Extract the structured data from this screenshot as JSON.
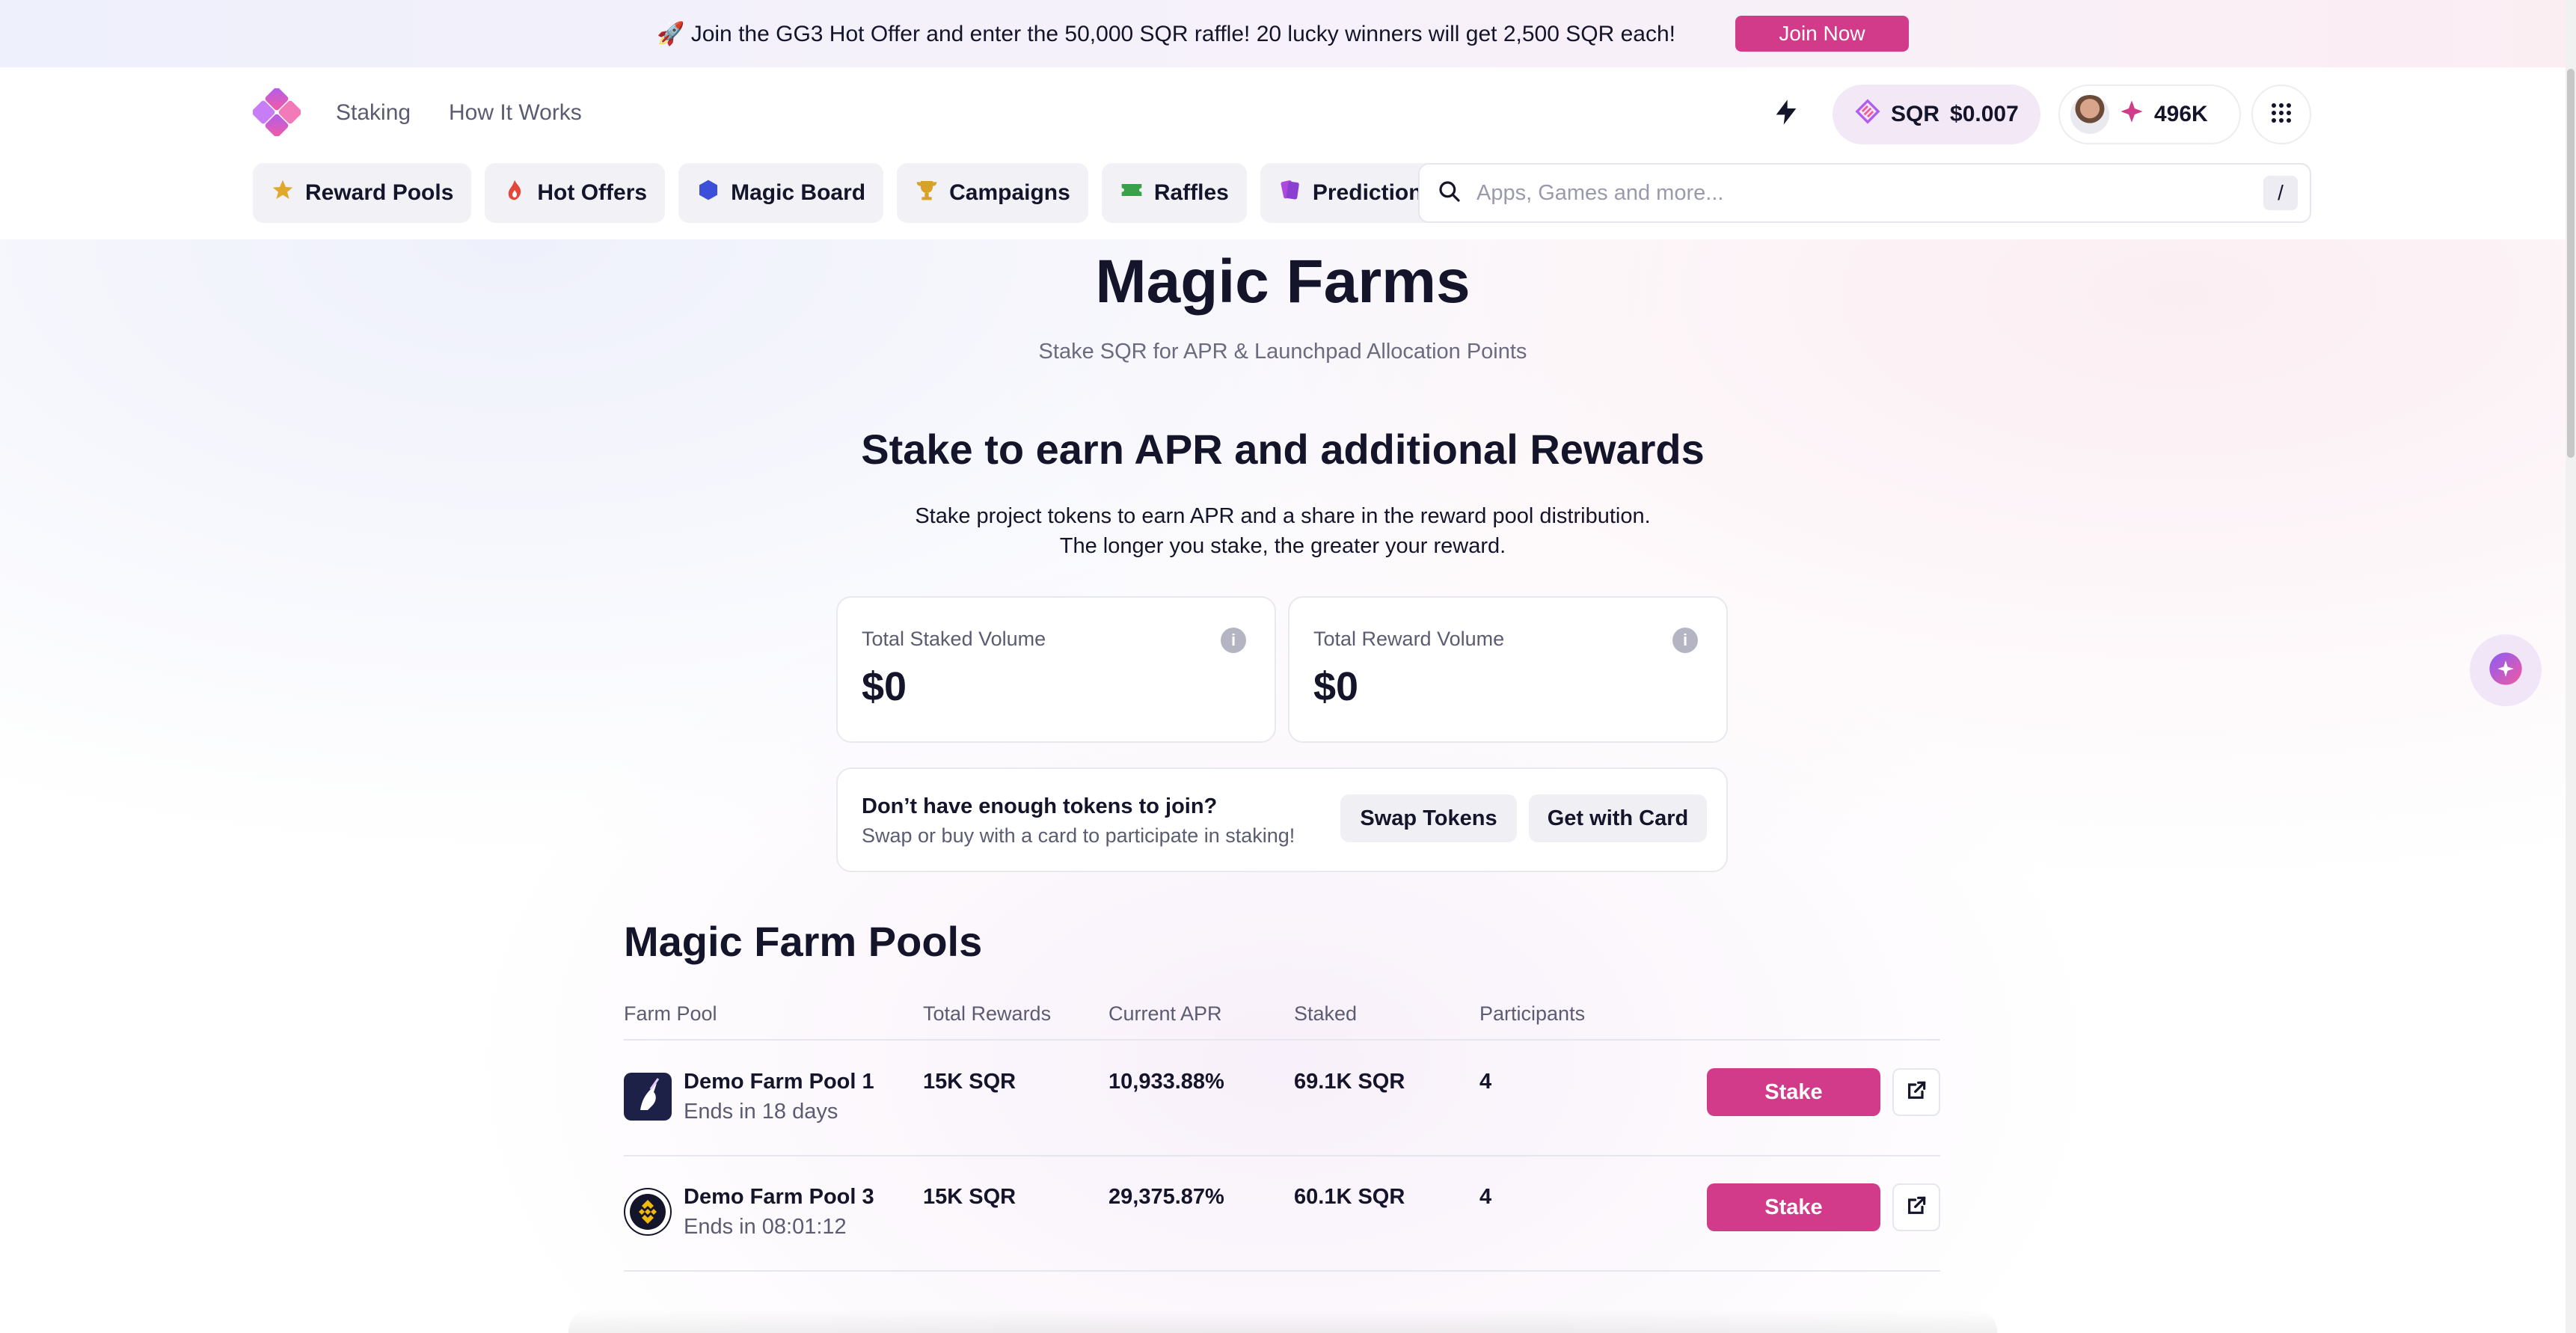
{
  "banner": {
    "text": "🚀 Join the GG3 Hot Offer and enter the 50,000 SQR raffle! 20 lucky winners will get 2,500 SQR each!",
    "button": "Join Now"
  },
  "nav": {
    "links": [
      "Staking",
      "How It Works"
    ],
    "price_token": "SQR",
    "price_value": "$0.007",
    "points": "496K"
  },
  "tabs": [
    {
      "label": "Reward Pools",
      "icon": "star-icon"
    },
    {
      "label": "Hot Offers",
      "icon": "fire-icon"
    },
    {
      "label": "Magic Board",
      "icon": "hexagon-icon"
    },
    {
      "label": "Campaigns",
      "icon": "trophy-icon"
    },
    {
      "label": "Raffles",
      "icon": "ticket-icon"
    },
    {
      "label": "Predictions",
      "icon": "cards-icon"
    }
  ],
  "search": {
    "placeholder": "Apps, Games and more...",
    "shortcut": "/"
  },
  "page": {
    "title": "Magic Farms",
    "subtitle": "Stake SQR for APR & Launchpad Allocation Points"
  },
  "section": {
    "title": "Stake to earn APR and additional Rewards",
    "desc_line1": "Stake project tokens to earn APR and a share in the reward pool distribution.",
    "desc_line2": "The longer you stake, the greater your reward."
  },
  "stats": {
    "staked_label": "Total Staked Volume",
    "staked_value": "$0",
    "reward_label": "Total Reward Volume",
    "reward_value": "$0"
  },
  "swap": {
    "title": "Don’t have enough tokens to join?",
    "subtitle": "Swap or buy with a card to participate in staking!",
    "swap_button": "Swap Tokens",
    "card_button": "Get with Card"
  },
  "pools": {
    "title": "Magic Farm Pools",
    "headers": [
      "Farm Pool",
      "Total Rewards",
      "Current APR",
      "Staked",
      "Participants"
    ],
    "rows": [
      {
        "name": "Demo Farm Pool 1",
        "ends": "Ends in 18 days",
        "rewards": "15K SQR",
        "apr": "10,933.88%",
        "staked": "69.1K SQR",
        "participants": "4",
        "action": "Stake"
      },
      {
        "name": "Demo Farm Pool 3",
        "ends": "Ends in 08:01:12",
        "rewards": "15K SQR",
        "apr": "29,375.87%",
        "staked": "60.1K SQR",
        "participants": "4",
        "action": "Stake"
      }
    ]
  },
  "colors": {
    "accent": "#d13b8a",
    "text": "#14142b",
    "muted": "#5b5b72"
  }
}
